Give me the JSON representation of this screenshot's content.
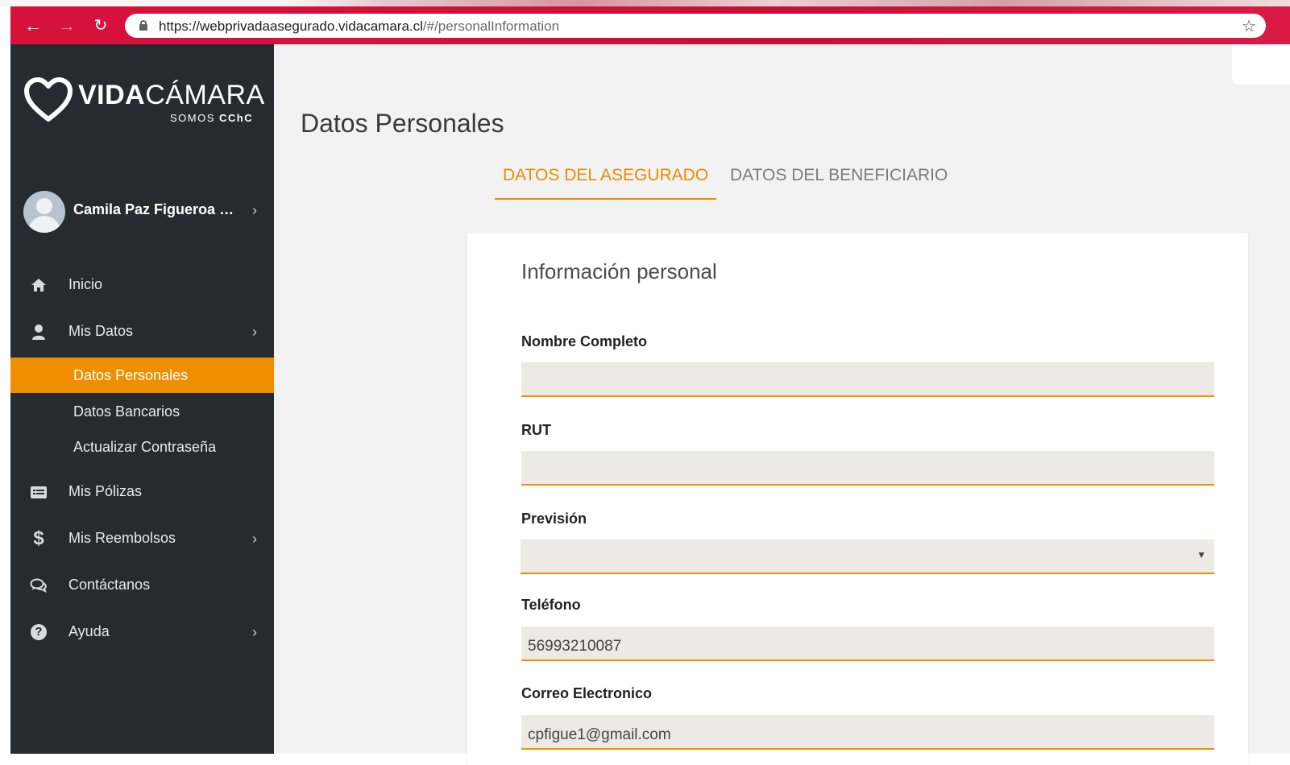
{
  "browser": {
    "url_host": "https://webprivadaasegurado.vidacamara.cl",
    "url_path": "/#/personalInformation"
  },
  "sidebar": {
    "logo": {
      "brand_bold": "VIDA",
      "brand_light": "CÁMARA",
      "tagline_light": "SOMOS ",
      "tagline_bold": "CChC"
    },
    "user_name": "Camila Paz Figueroa Ze...",
    "menu": [
      {
        "label": "Inicio",
        "icon": "home-icon"
      },
      {
        "label": "Mis Datos",
        "icon": "user-icon",
        "expandable": true
      },
      {
        "label": "Mis Pólizas",
        "icon": "policy-card-icon"
      },
      {
        "label": "Mis Reembolsos",
        "icon": "dollar-icon",
        "expandable": true
      },
      {
        "label": "Contáctanos",
        "icon": "chat-icon"
      },
      {
        "label": "Ayuda",
        "icon": "help-icon",
        "expandable": true
      }
    ],
    "submenu": [
      {
        "label": "Datos Personales",
        "active": true
      },
      {
        "label": "Datos Bancarios",
        "active": false
      },
      {
        "label": "Actualizar Contraseña",
        "active": false
      }
    ]
  },
  "main": {
    "page_title": "Datos Personales",
    "tabs": [
      {
        "label": "DATOS DEL ASEGURADO",
        "active": true
      },
      {
        "label": "DATOS DEL BENEFICIARIO",
        "active": false
      }
    ],
    "card_title": "Información personal",
    "fields": {
      "full_name": {
        "label": "Nombre Completo",
        "value": ""
      },
      "rut": {
        "label": "RUT",
        "value": ""
      },
      "prevision": {
        "label": "Previsión",
        "value": ""
      },
      "phone": {
        "label": "Teléfono",
        "value": "56993210087"
      },
      "email": {
        "label": "Correo Electronico",
        "value": "cpfigue1@gmail.com"
      }
    }
  },
  "colors": {
    "accent": "#ef8f00",
    "sidebar_bg": "#252b31",
    "browser_bar": "#d6113b",
    "input_bg": "#ebeae4"
  }
}
